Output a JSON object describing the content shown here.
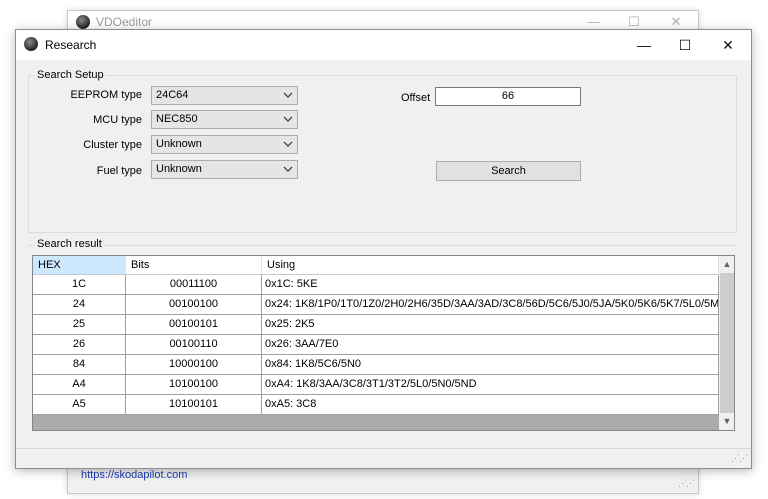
{
  "background_window": {
    "title": "VDOeditor",
    "link": "https://skodapilot.com",
    "minimize": "—",
    "maximize": "☐",
    "close": "✕"
  },
  "dialog": {
    "title": "Research",
    "minimize": "—",
    "maximize": "☐",
    "close": "✕"
  },
  "search_setup": {
    "group_label": "Search Setup",
    "eeprom_label": "EEPROM type",
    "eeprom_value": "24C64",
    "mcu_label": "MCU type",
    "mcu_value": "NEC850",
    "cluster_label": "Cluster type",
    "cluster_value": "Unknown",
    "fuel_label": "Fuel type",
    "fuel_value": "Unknown",
    "offset_label": "Offset",
    "offset_value": "66",
    "search_button": "Search"
  },
  "search_result": {
    "group_label": "Search result",
    "columns": [
      "HEX",
      "Bits",
      "Using"
    ],
    "rows": [
      {
        "hex": "1C",
        "bits": "00011100",
        "using": "0x1C: 5KE"
      },
      {
        "hex": "24",
        "bits": "00100100",
        "using": "0x24: 1K8/1P0/1T0/1Z0/2H0/2H6/35D/3AA/3AD/3C8/56D/5C6/5J0/5JA/5K0/5K6/5K7/5L0/5M..."
      },
      {
        "hex": "25",
        "bits": "00100101",
        "using": "0x25: 2K5"
      },
      {
        "hex": "26",
        "bits": "00100110",
        "using": "0x26: 3AA/7E0"
      },
      {
        "hex": "84",
        "bits": "10000100",
        "using": "0x84: 1K8/5C6/5N0"
      },
      {
        "hex": "A4",
        "bits": "10100100",
        "using": "0xA4: 1K8/3AA/3C8/3T1/3T2/5L0/5N0/5ND"
      },
      {
        "hex": "A5",
        "bits": "10100101",
        "using": "0xA5: 3C8"
      }
    ]
  },
  "colors": {
    "selected_header": "#cce8ff",
    "dialog_bg": "#f0f0f0",
    "link": "#1a3cb0"
  }
}
